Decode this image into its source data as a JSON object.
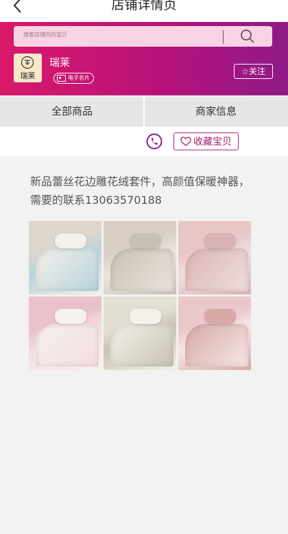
{
  "nav": {
    "title": "店铺详情页",
    "back_icon": "chevron-left-icon"
  },
  "header": {
    "search_placeholder": "搜索店铺内的宝贝",
    "shop_name": "瑞莱",
    "logo_text": "瑞莱",
    "card_label": "电子名片",
    "follow_label": "☆关注",
    "colors": {
      "gradient_start": "#d9196a",
      "gradient_end": "#8e1a86"
    }
  },
  "tabs": [
    {
      "label": "全部商品"
    },
    {
      "label": "商家信息"
    }
  ],
  "actions": {
    "phone_icon": "phone-icon",
    "favorite_label": "收藏宝贝"
  },
  "content": {
    "description": "新品蕾丝花边雕花绒套件，高颜值保暖神器，需要的联系13063570188",
    "photos": [
      {
        "name": "bedding-photo-1",
        "palette": [
          "#dcd6cc",
          "#b9d3dd",
          "#f3f0ea"
        ]
      },
      {
        "name": "bedding-photo-2",
        "palette": [
          "#d9cfc4",
          "#e9e4dc",
          "#c9c0b4"
        ]
      },
      {
        "name": "bedding-photo-3",
        "palette": [
          "#e7c6c6",
          "#f1dede",
          "#d9b3b3"
        ]
      },
      {
        "name": "bedding-photo-4",
        "palette": [
          "#e9c1c8",
          "#f4dde2",
          "#f5f1ec"
        ]
      },
      {
        "name": "bedding-photo-5",
        "palette": [
          "#e3dfd3",
          "#c9c3b3",
          "#f3f1ea"
        ]
      },
      {
        "name": "bedding-photo-6",
        "palette": [
          "#eac8c9",
          "#f6e6e4",
          "#d7aaa8"
        ]
      }
    ]
  }
}
